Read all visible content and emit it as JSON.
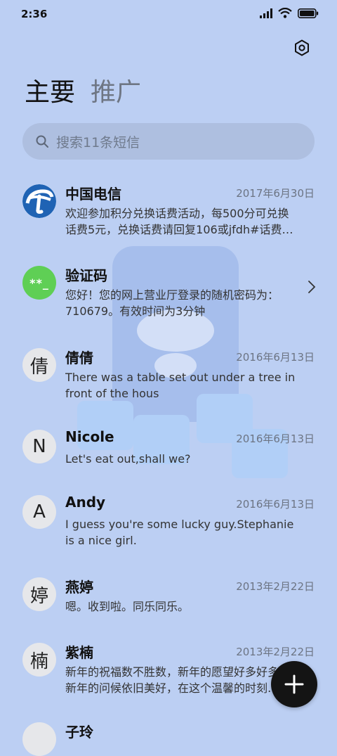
{
  "status_bar": {
    "time": "2:36",
    "icons": [
      "signal-icon",
      "wifi-icon",
      "battery-icon"
    ]
  },
  "header": {
    "settings_icon": "settings-icon"
  },
  "tabs": [
    {
      "label": "主要",
      "active": true
    },
    {
      "label": "推广",
      "active": false
    }
  ],
  "search": {
    "placeholder": "搜索11条短信"
  },
  "conversations": [
    {
      "name": "中国电信",
      "avatar": "",
      "avatar_type": "telecom-logo",
      "date": "2017年6月30日",
      "preview_lines": [
        "欢迎参加积分兑换话费活动，每500分可兑换",
        "话费5元，兑换话费请回复106或jfdh#话费…"
      ]
    },
    {
      "name": "验证码",
      "avatar": "**_",
      "avatar_type": "otp",
      "date": "",
      "preview_lines": [
        "您好！您的网上营业厅登录的随机密码为：",
        "710679。有效时间为3分钟"
      ]
    },
    {
      "name": "倩倩",
      "avatar": "倩",
      "avatar_type": "letter",
      "date": "2016年6月13日",
      "preview_lines": [
        "There was a table set out under a tree in",
        "front of the hous"
      ]
    },
    {
      "name": "Nicole",
      "avatar": "N",
      "avatar_type": "letter",
      "date": "2016年6月13日",
      "preview_lines": [
        "Let's eat out,shall we?"
      ]
    },
    {
      "name": "Andy",
      "avatar": "A",
      "avatar_type": "letter",
      "date": "2016年6月13日",
      "preview_lines": [
        "I guess you're some lucky guy.Stephanie",
        "is a nice girl."
      ]
    },
    {
      "name": "燕婷",
      "avatar": "婷",
      "avatar_type": "letter",
      "date": "2013年2月22日",
      "preview_lines": [
        "嗯。收到啦。同乐同乐。"
      ]
    },
    {
      "name": "紫楠",
      "avatar": "楠",
      "avatar_type": "letter",
      "date": "2013年2月22日",
      "preview_lines": [
        "新年的祝福数不胜数，新年的愿望好多好多，",
        "新年的问候依旧美好，在这个温馨的时刻…"
      ]
    },
    {
      "name": "子玲",
      "avatar": "",
      "avatar_type": "letter",
      "date": "",
      "preview_lines": []
    }
  ],
  "fab": {
    "icon": "plus-icon"
  },
  "colors": {
    "background": "#bccff3",
    "otp_avatar": "#5fcf55",
    "telecom_blue": "#1f63b4",
    "fab": "#141414"
  }
}
